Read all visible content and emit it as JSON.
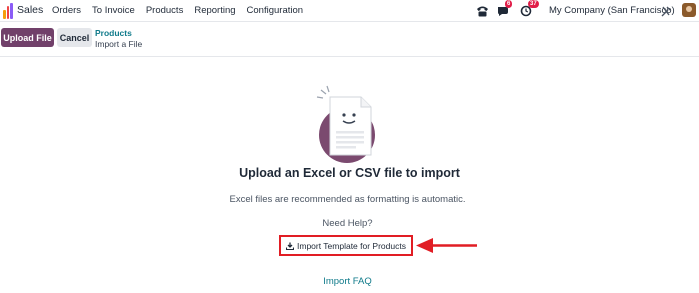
{
  "navbar": {
    "app_name": "Sales",
    "menu": [
      "Orders",
      "To Invoice",
      "Products",
      "Reporting",
      "Configuration"
    ],
    "chat_badge": "6",
    "activity_badge": "37",
    "company": "My Company (San Francisco)"
  },
  "control_panel": {
    "upload_label": "Upload File",
    "cancel_label": "Cancel",
    "breadcrumb_parent": "Products",
    "breadcrumb_current": "Import a File"
  },
  "main": {
    "title": "Upload an Excel or CSV file to import",
    "subtitle": "Excel files are recommended as formatting is automatic.",
    "help_label": "Need Help?",
    "template_link": "Import Template for Products",
    "faq_link": "Import FAQ"
  },
  "colors": {
    "primary": "#71406a",
    "link": "#0f7a8a",
    "annotation": "#e11d24"
  }
}
